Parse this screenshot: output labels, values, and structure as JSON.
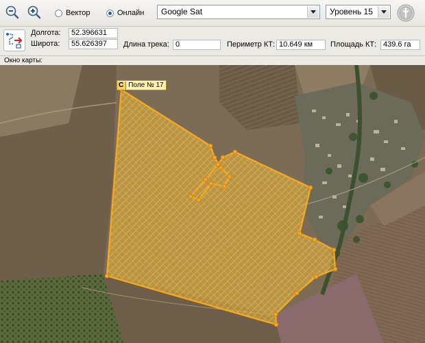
{
  "toolbar": {
    "mode_vector_label": "Вектор",
    "mode_online_label": "Онлайн",
    "map_source": "Google Sat",
    "zoom_level": "Уровень 15"
  },
  "info": {
    "lon_label": "Долгота:",
    "lon_value": "52.396631",
    "lat_label": "Широта:",
    "lat_value": "55.626397",
    "track_label": "Длина трека:",
    "track_value": "0",
    "perimeter_label": "Периметр КТ:",
    "perimeter_value": "10.649 км",
    "area_label": "Площадь КТ:",
    "area_value": "439.6 га"
  },
  "map_window_label": "Окно карты:",
  "field_tag": {
    "letter": "С",
    "name": "Поле № 17"
  },
  "colors": {
    "polygon_stroke": "#f5a623",
    "polygon_fill": "#e8b53a"
  }
}
